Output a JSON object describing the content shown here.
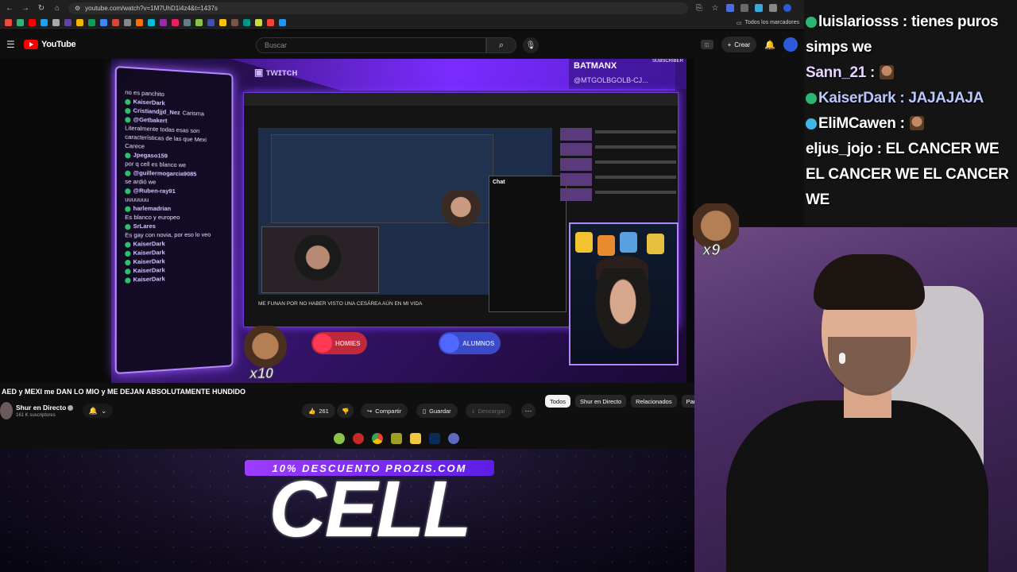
{
  "browser": {
    "url": "youtube.com/watch?v=1M7UhD1i4z4&t=1437s",
    "bookmarks_folder": "Todos los marcadores"
  },
  "youtube": {
    "brand": "YouTube",
    "search_placeholder": "Buscar",
    "create_label": "Crear"
  },
  "video": {
    "overlay": {
      "top_right_name": "BATMANX",
      "top_right_handle": "@MTGOLBGOLB-CJ...",
      "subscriber_tag": "SUBSCRIBER",
      "chat_lines": [
        {
          "user": "",
          "text": "no es panchito"
        },
        {
          "user": "KaiserDark",
          "text": ""
        },
        {
          "user": "Cristiandjjd_Nez",
          "text": "Carisma"
        },
        {
          "user": "@Getbakert",
          "text": ""
        },
        {
          "user": "",
          "text": "Literalmente todas esas son"
        },
        {
          "user": "",
          "text": "características de las que Mexi"
        },
        {
          "user": "",
          "text": "Carece"
        },
        {
          "user": "Jpegaso159",
          "text": ""
        },
        {
          "user": "",
          "text": "por q cell es blanco we"
        },
        {
          "user": "@guillermogarcia9085",
          "text": ""
        },
        {
          "user": "",
          "text": "se ardió we"
        },
        {
          "user": "@Ruben-ray91",
          "text": ""
        },
        {
          "user": "",
          "text": "uuuuuuu"
        },
        {
          "user": "harlemadrian",
          "text": ""
        },
        {
          "user": "",
          "text": "Es blanco y europeo"
        },
        {
          "user": "SrLares",
          "text": ""
        },
        {
          "user": "",
          "text": "Es gay con novia, por eso lo veo"
        },
        {
          "user": "KaiserDark",
          "text": ""
        },
        {
          "user": "KaiserDark",
          "text": ""
        },
        {
          "user": "KaiserDark",
          "text": ""
        },
        {
          "user": "KaiserDark",
          "text": ""
        },
        {
          "user": "KaiserDark",
          "text": ""
        }
      ],
      "nested_chat_title": "Chat",
      "nested_caption": "ME FUNAN POR NO HABER VISTO UNA CESÁREA AÚN EN MI VIDA",
      "badge_left": "HOMIES",
      "badge_right": "ALUMNOS",
      "sticker_bottom": "x10"
    },
    "title": "AED y MEXI me DAN LO MIO y ME DEJAN ABSOLUTAMENTE HUNDIDO",
    "channel_name": "Shur en Directo",
    "channel_subs": "161 K suscriptores",
    "likes": "261",
    "share_label": "Compartir",
    "save_label": "Guardar",
    "download_label": "Descargar",
    "filter_chips": [
      "Todos",
      "Shur en Directo",
      "Relacionados",
      "Par"
    ]
  },
  "promo": {
    "banner": "10% DESCUENTO PROZIS.COM",
    "word": "CELL"
  },
  "live_chat": [
    {
      "user": "",
      "text": "luislariosss : tienes puros simps we",
      "color": "#ffffff",
      "badge": "#2bb673"
    },
    {
      "user": "Sann_21",
      "text": "Sann_21 :",
      "color": "#e8d5ff",
      "badge": ""
    },
    {
      "user": "KaiserDark",
      "text": "KaiserDark : JAJAJAJA",
      "color": "#b9c7ff",
      "badge": "#2bb673"
    },
    {
      "user": "EliMCawen",
      "text": "EliMCawen :",
      "color": "#ffffff",
      "badge": "#3fb8e8"
    },
    {
      "user": "eljus_jojo",
      "text": "eljus_jojo : EL CANCER WE EL CANCER WE EL CANCER WE",
      "color": "#ffffff",
      "badge": ""
    }
  ],
  "stickers": {
    "right": "x9"
  }
}
